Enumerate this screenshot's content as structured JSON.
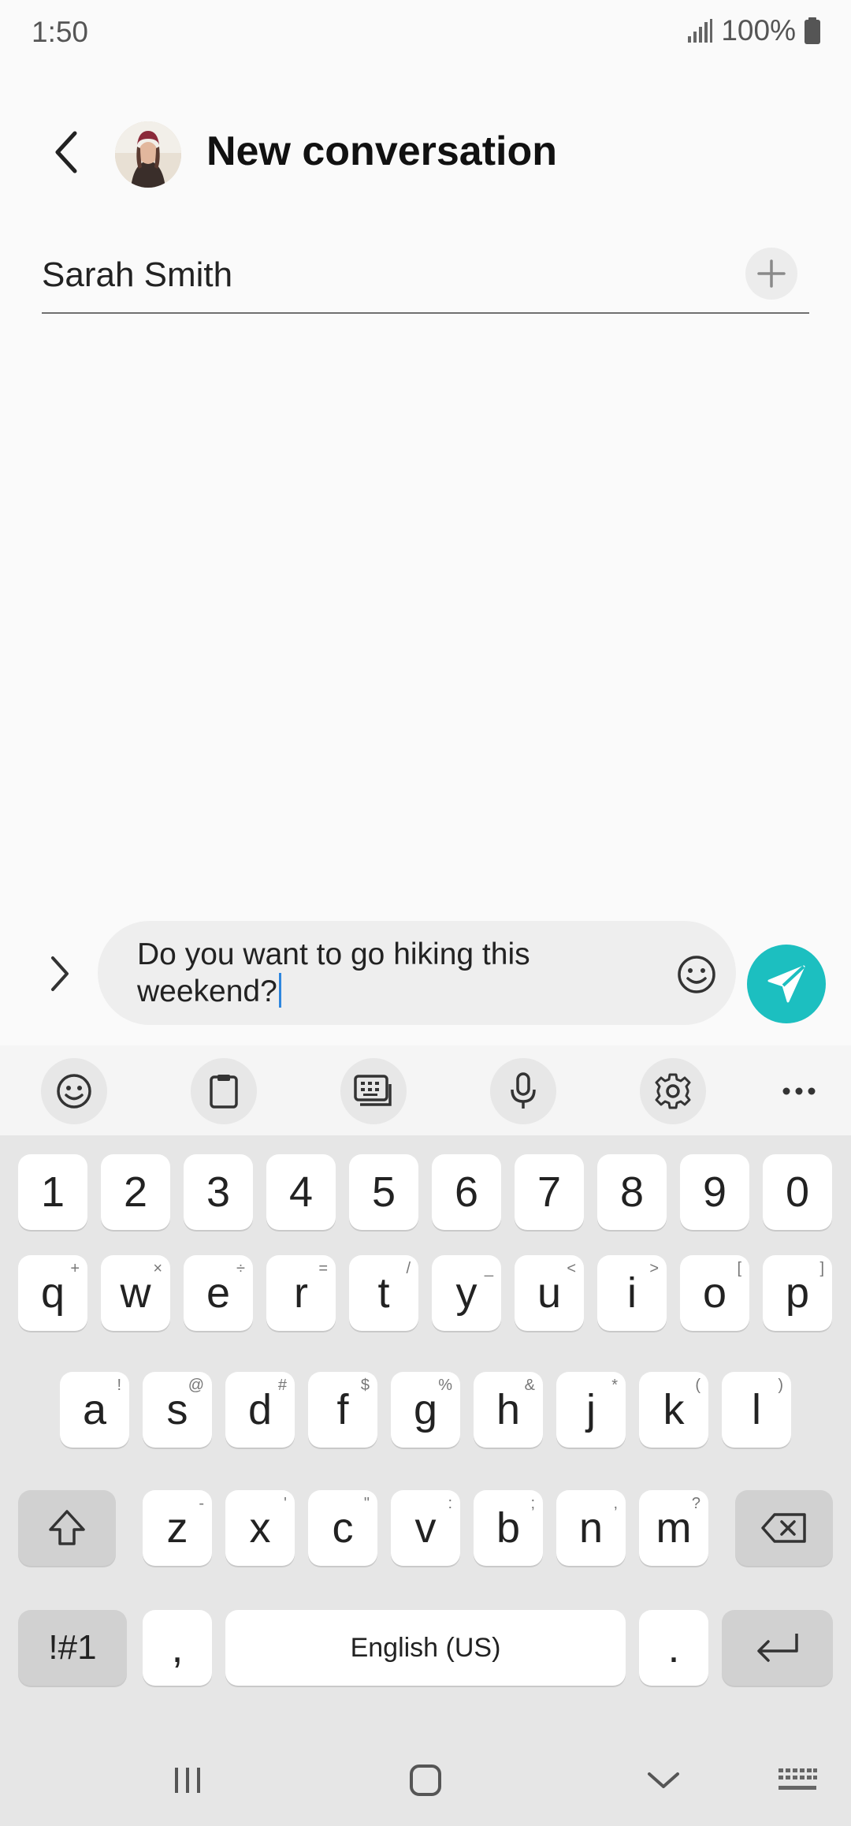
{
  "status": {
    "time": "1:50",
    "battery": "100%"
  },
  "header": {
    "title": "New conversation"
  },
  "recipient": {
    "name": "Sarah Smith"
  },
  "compose": {
    "text": "Do you want to go hiking this weekend?"
  },
  "colors": {
    "accent": "#1cbfc0",
    "caret": "#2e86de"
  },
  "keyboard": {
    "toolbar": [
      "emoji-icon",
      "clipboard-icon",
      "keyboard-mode-icon",
      "microphone-icon",
      "settings-icon",
      "more-icon"
    ],
    "numbers": [
      "1",
      "2",
      "3",
      "4",
      "5",
      "6",
      "7",
      "8",
      "9",
      "0"
    ],
    "row1": [
      {
        "k": "q",
        "h": "+"
      },
      {
        "k": "w",
        "h": "×"
      },
      {
        "k": "e",
        "h": "÷"
      },
      {
        "k": "r",
        "h": "="
      },
      {
        "k": "t",
        "h": "/"
      },
      {
        "k": "y",
        "h": "_"
      },
      {
        "k": "u",
        "h": "<"
      },
      {
        "k": "i",
        "h": ">"
      },
      {
        "k": "o",
        "h": "["
      },
      {
        "k": "p",
        "h": "]"
      }
    ],
    "row2": [
      {
        "k": "a",
        "h": "!"
      },
      {
        "k": "s",
        "h": "@"
      },
      {
        "k": "d",
        "h": "#"
      },
      {
        "k": "f",
        "h": "$"
      },
      {
        "k": "g",
        "h": "%"
      },
      {
        "k": "h",
        "h": "&"
      },
      {
        "k": "j",
        "h": "*"
      },
      {
        "k": "k",
        "h": "("
      },
      {
        "k": "l",
        "h": ")"
      }
    ],
    "row3": [
      {
        "k": "z",
        "h": "-"
      },
      {
        "k": "x",
        "h": "'"
      },
      {
        "k": "c",
        "h": "\""
      },
      {
        "k": "v",
        "h": ":"
      },
      {
        "k": "b",
        "h": ";"
      },
      {
        "k": "n",
        "h": ","
      },
      {
        "k": "m",
        "h": "?"
      }
    ],
    "symbols_label": "!#1",
    "comma_label": ",",
    "space_label": "English (US)",
    "period_label": "."
  }
}
